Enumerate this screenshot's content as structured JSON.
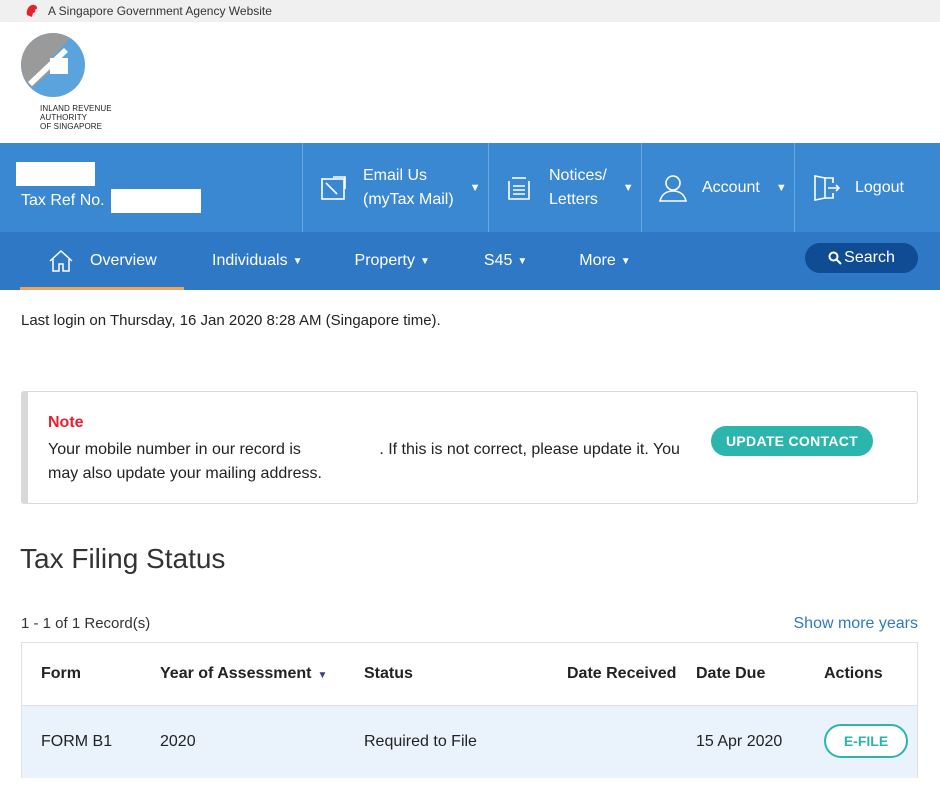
{
  "gov_bar": {
    "text": "A Singapore Government Agency Website"
  },
  "logo": {
    "line1": "INLAND REVENUE",
    "line2": "AUTHORITY",
    "line3": "OF SINGAPORE"
  },
  "account": {
    "tax_ref_label": "Tax Ref No."
  },
  "topbar": {
    "email_line1": "Email Us",
    "email_line2": "(myTax Mail)",
    "notices_line1": "Notices/",
    "notices_line2": "Letters",
    "account_label": "Account",
    "logout_label": "Logout"
  },
  "nav": {
    "overview": "Overview",
    "individuals": "Individuals",
    "property": "Property",
    "s45": "S45",
    "more": "More",
    "search": "Search"
  },
  "last_login": "Last login on Thursday, 16 Jan 2020 8:28 AM (Singapore time).",
  "note": {
    "title": "Note",
    "text_part1": "Your mobile number in our record is",
    "text_part2": ". If this is not correct, please update it. You may also update your mailing address.",
    "button": "UPDATE CONTACT"
  },
  "filing": {
    "title": "Tax Filing Status",
    "record_count": "1 - 1 of 1 Record(s)",
    "show_more": "Show more years",
    "columns": {
      "form": "Form",
      "year": "Year of Assessment",
      "status": "Status",
      "date_received": "Date Received",
      "date_due": "Date Due",
      "actions": "Actions"
    },
    "rows": [
      {
        "form": "FORM B1",
        "year": "2020",
        "status": "Required to File",
        "date_received": "",
        "date_due": "15 Apr 2020",
        "action": "E-FILE"
      }
    ]
  },
  "colors": {
    "topbar": "#3a87d2",
    "navbar": "#2f78c6",
    "accent_teal": "#2cb5ad",
    "note_red": "#e8212e",
    "search_button": "#0f4c93"
  }
}
